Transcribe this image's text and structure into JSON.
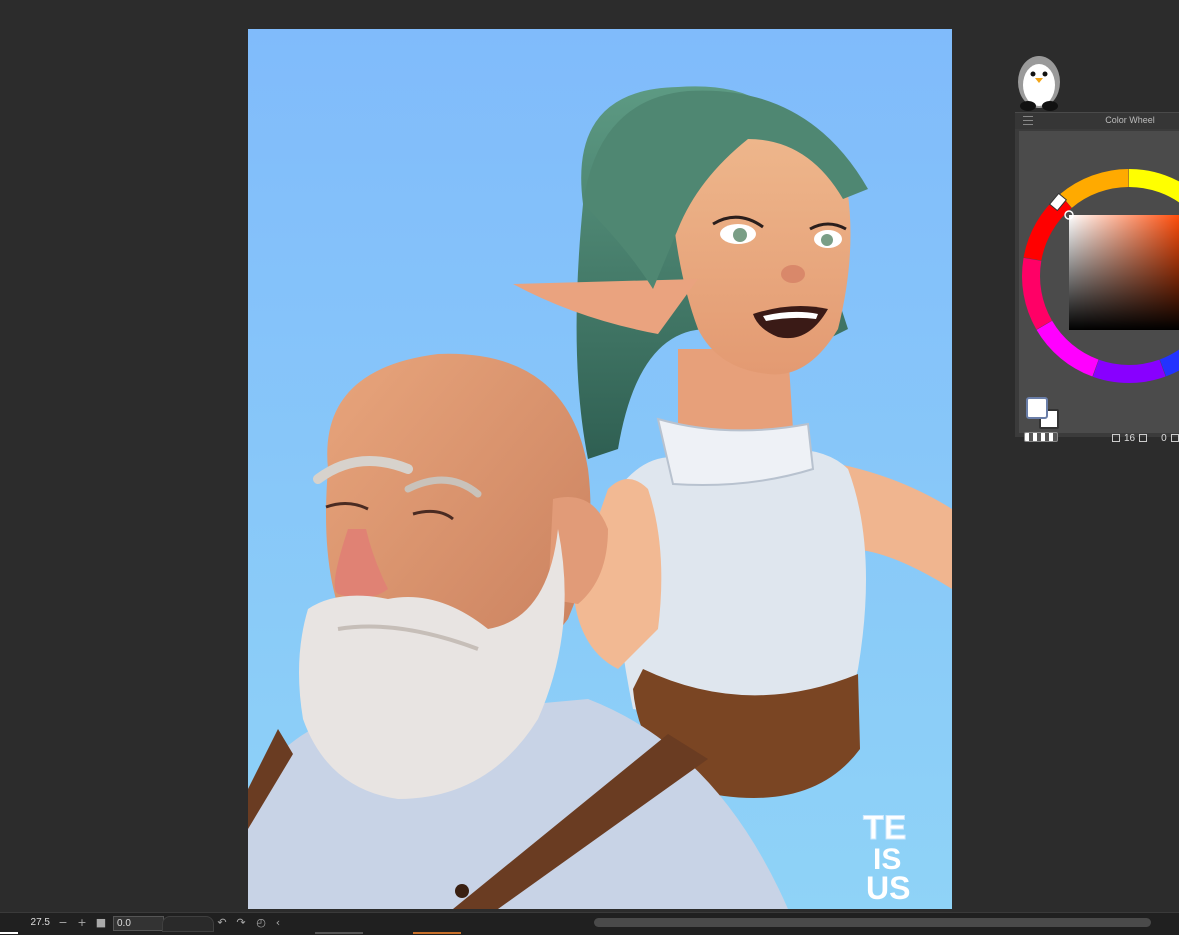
{
  "color_wheel_panel": {
    "title": "Color Wheel",
    "main_color": "#ffffff",
    "sub_color": "#ffffff",
    "hue_color": "#ff4500",
    "brush_size_value": "16",
    "opacity_value": "0"
  },
  "statusbar": {
    "zoom": "27.5",
    "rotation": "0.0"
  },
  "artwork": {
    "signature": "TE IS US",
    "background_top": "#80bbfb",
    "background_bottom": "#8fd2f8"
  }
}
